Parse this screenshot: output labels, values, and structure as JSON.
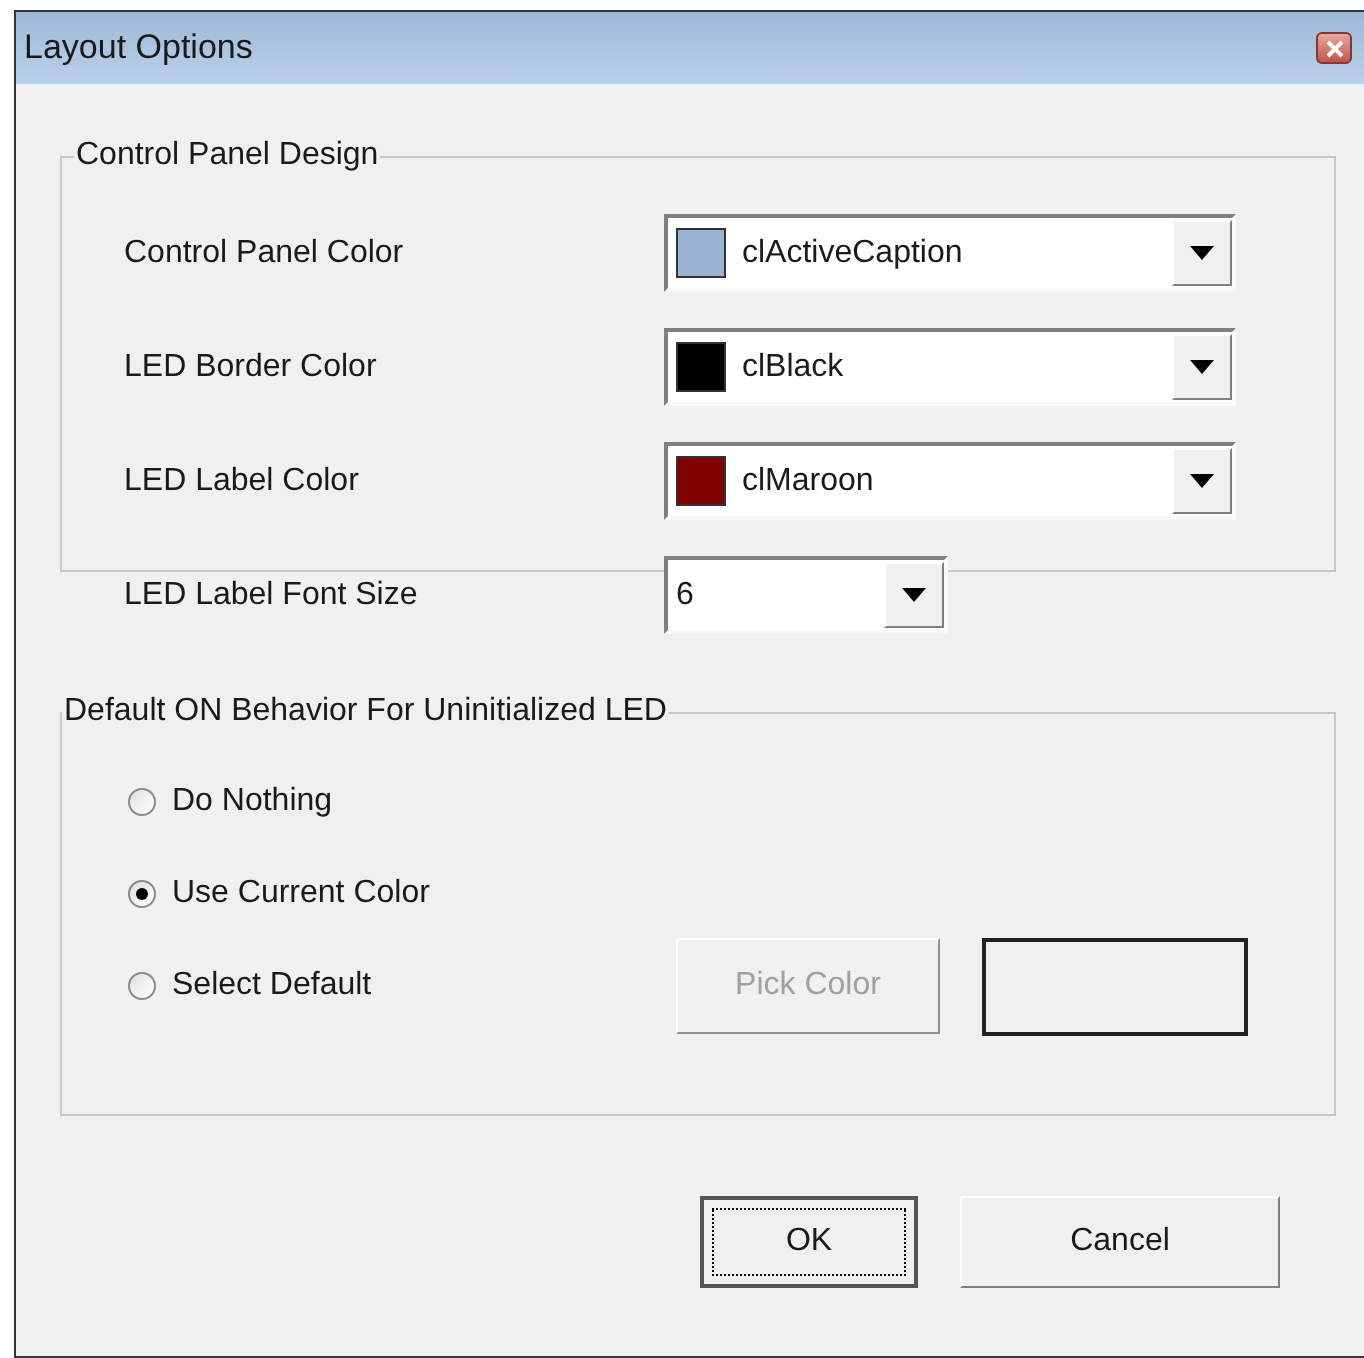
{
  "window": {
    "title": "Layout Options"
  },
  "control_panel_design": {
    "title": "Control Panel Design",
    "rows": [
      {
        "kind": "color",
        "label": "Control Panel Color",
        "value": "clActiveCaption",
        "color": "#99b4d1"
      },
      {
        "kind": "color",
        "label": "LED Border Color",
        "value": "clBlack",
        "color": "#000000"
      },
      {
        "kind": "color",
        "label": "LED Label Color",
        "value": "clMaroon",
        "color": "#800000"
      },
      {
        "kind": "plain",
        "label": "LED Label Font Size",
        "value": "6"
      }
    ]
  },
  "default_on_behavior": {
    "title": "Default ON Behavior For Uninitialized LED",
    "options": [
      {
        "label": "Do Nothing",
        "selected": false
      },
      {
        "label": "Use Current Color",
        "selected": true
      },
      {
        "label": "Select Default",
        "selected": false
      }
    ],
    "pick_button": {
      "label": "Pick Color",
      "disabled": true
    }
  },
  "buttons": [
    {
      "label": "OK",
      "focused": true
    },
    {
      "label": "Cancel",
      "focused": false
    }
  ]
}
